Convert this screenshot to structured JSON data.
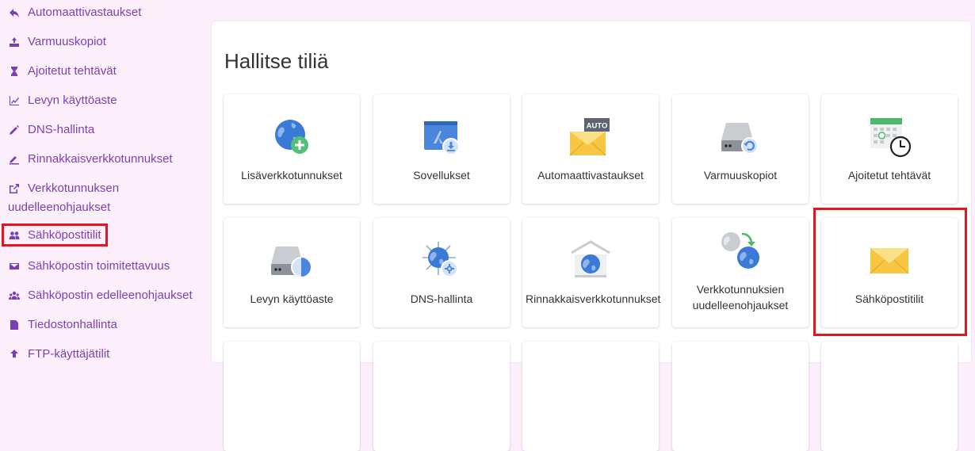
{
  "sidebar": {
    "items": [
      {
        "label": "Automaattivastaukset",
        "icon": "reply-icon"
      },
      {
        "label": "Varmuuskopiot",
        "icon": "backup-icon"
      },
      {
        "label": "Ajoitetut tehtävät",
        "icon": "hourglass-icon"
      },
      {
        "label": "Levyn käyttöaste",
        "icon": "chart-line-icon"
      },
      {
        "label": "DNS-hallinta",
        "icon": "pencil-icon"
      },
      {
        "label": "Rinnakkaisverkkotunnukset",
        "icon": "edit-line-icon"
      },
      {
        "label": "Verkkotunnuksen uudelleenohjaukset",
        "icon": "external-link-icon"
      },
      {
        "label": "Sähköpostitilit",
        "icon": "users-icon"
      },
      {
        "label": "Sähköpostin toimitettavuus",
        "icon": "envelope-icon"
      },
      {
        "label": "Sähköpostin edelleenohjaukset",
        "icon": "group-icon"
      },
      {
        "label": "Tiedostonhallinta",
        "icon": "file-icon"
      },
      {
        "label": "FTP-käyttäjätilit",
        "icon": "upload-icon"
      }
    ]
  },
  "main": {
    "title": "Hallitse tiliä",
    "cards": [
      {
        "label": "Lisäverkkotunnukset",
        "icon": "globe-add-icon"
      },
      {
        "label": "Sovellukset",
        "icon": "app-folder-icon"
      },
      {
        "label": "Automaattivastaukset",
        "icon": "auto-reply-envelope-icon",
        "badge": "AUTO"
      },
      {
        "label": "Varmuuskopiot",
        "icon": "backup-drive-icon"
      },
      {
        "label": "Ajoitetut tehtävät",
        "icon": "calendar-clock-icon"
      },
      {
        "label": "Levyn käyttöaste",
        "icon": "disk-usage-icon"
      },
      {
        "label": "DNS-hallinta",
        "icon": "dns-globe-icon"
      },
      {
        "label": "Rinnakkaisverkkotunnukset",
        "icon": "parked-domain-icon"
      },
      {
        "label": "Verkkotunnuksien uudelleenohjaukset",
        "icon": "redirect-globe-icon"
      },
      {
        "label": "Sähköpostitilit",
        "icon": "envelope-icon"
      }
    ]
  },
  "colors": {
    "sidebar_text": "#7b3fb5",
    "background": "#fdf0fc",
    "highlight": "#e1161e",
    "globe": "#3a7ad6",
    "envelope": "#f7c744"
  }
}
